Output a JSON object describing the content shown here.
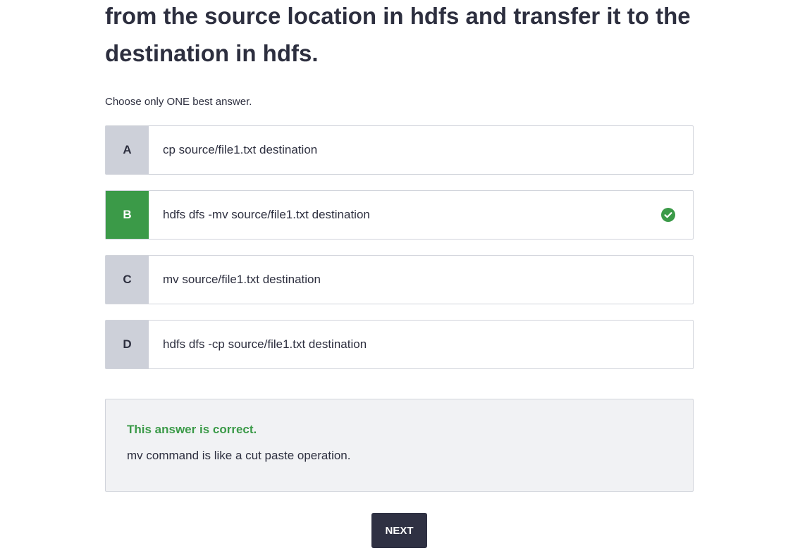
{
  "question": {
    "text": "from the source location in hdfs and transfer it to the destination in hdfs."
  },
  "instruction": "Choose only ONE best answer.",
  "options": [
    {
      "letter": "A",
      "text": "cp source/file1.txt destination",
      "state": "default"
    },
    {
      "letter": "B",
      "text": "hdfs dfs -mv source/file1.txt destination",
      "state": "correct"
    },
    {
      "letter": "C",
      "text": "mv source/file1.txt destination",
      "state": "default"
    },
    {
      "letter": "D",
      "text": "hdfs dfs -cp source/file1.txt destination",
      "state": "default"
    }
  ],
  "feedback": {
    "status": "This answer is correct.",
    "explanation": "mv command is like a cut paste operation."
  },
  "next_button": {
    "label": "NEXT"
  },
  "colors": {
    "correct": "#3b9a48",
    "letter_default_bg": "#cdd0d9",
    "button_bg": "#2f3143",
    "feedback_bg": "#f1f2f4"
  },
  "icons": {
    "correct_marker": "check-circle-icon"
  }
}
